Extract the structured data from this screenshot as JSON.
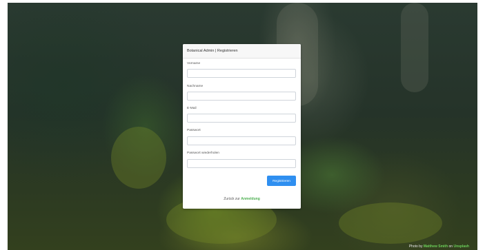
{
  "card": {
    "title": "Botanical Admin | Registrieren"
  },
  "form": {
    "fields": [
      {
        "label": "Vorname",
        "value": ""
      },
      {
        "label": "Nachname",
        "value": ""
      },
      {
        "label": "E-Mail",
        "value": ""
      },
      {
        "label": "Passwort",
        "value": ""
      },
      {
        "label": "Passwort wiederholen",
        "value": ""
      }
    ],
    "submit_label": "Registrieren"
  },
  "footer": {
    "back_text": "Zurück zur",
    "back_link": "Anmeldung"
  },
  "photo_credit": {
    "prefix": "Photo by",
    "author": "Matthew Smith",
    "middle": "on",
    "site": "Unsplash"
  },
  "colors": {
    "primary_button": "#2f8ff0",
    "link_green": "#4caf50"
  }
}
